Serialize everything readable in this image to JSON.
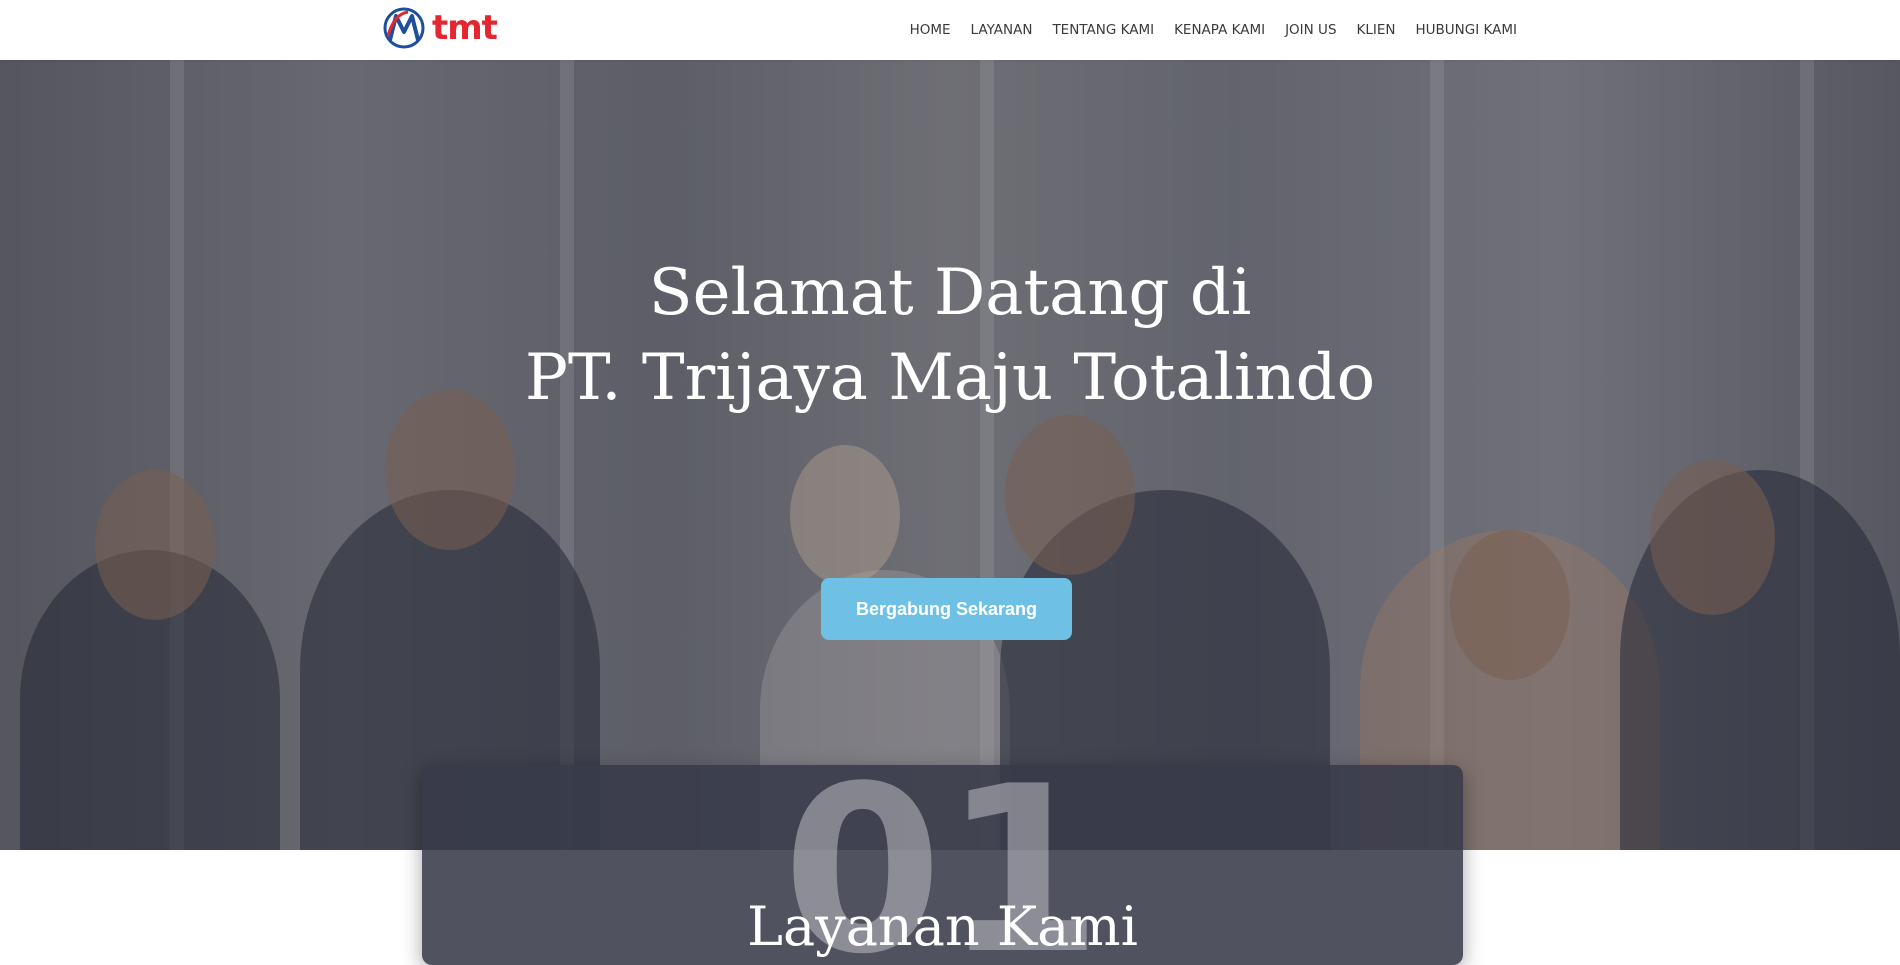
{
  "brand": {
    "logo_text": "tmt",
    "accent": "#e3262f",
    "mark_blue": "#1d4f9c"
  },
  "nav": {
    "items": [
      {
        "label": "HOME"
      },
      {
        "label": "LAYANAN"
      },
      {
        "label": "TENTANG KAMI"
      },
      {
        "label": "KENAPA KAMI"
      },
      {
        "label": "JOIN US"
      },
      {
        "label": "KLIEN"
      },
      {
        "label": "HUBUNGI KAMI"
      }
    ]
  },
  "hero": {
    "title_line1": "Selamat Datang di",
    "title_line2": "PT. Trijaya Maju Totalindo",
    "cta_label": "Bergabung Sekarang",
    "cta_color": "#6ec1e4"
  },
  "services_card": {
    "number": "01",
    "title": "Layanan Kami"
  }
}
